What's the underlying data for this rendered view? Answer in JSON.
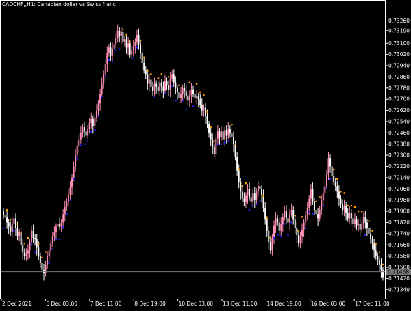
{
  "header": {
    "symbol_label": "CADCHF,,H1:  Canadian dollar vs Swiss franc"
  },
  "colors": {
    "background": "#000000",
    "axis": "#ffffff",
    "bull_candle": "#ff8fb4",
    "bear_candle": "#ffffff",
    "dot_support": "#2222ff",
    "dot_resistance": "#ffa500",
    "price_line": "#787878",
    "price_tag_bg": "#787878"
  },
  "chart_data": {
    "type": "candlestick",
    "title": "CADCHF,,H1:  Canadian dollar vs Swiss franc",
    "ylim": [
      0.713,
      0.7336
    ],
    "y_ticks": [
      "0.73260",
      "0.73190",
      "0.73100",
      "0.73020",
      "0.72940",
      "0.72860",
      "0.72780",
      "0.72700",
      "0.72620",
      "0.72540",
      "0.72460",
      "0.72380",
      "0.72300",
      "0.72220",
      "0.72140",
      "0.72060",
      "0.71980",
      "0.71900",
      "0.71820",
      "0.71740",
      "0.71660",
      "0.71580",
      "0.71500",
      "0.71420",
      "0.71340"
    ],
    "x_ticks": [
      "2 Dec 2021",
      "6 Dec 03:00",
      "7 Dec 11:00",
      "8 Dec 19:00",
      "10 Dec 03:00",
      "13 Dec 11:00",
      "14 Dec 19:00",
      "16 Dec 03:00",
      "17 Dec 11:00"
    ],
    "current_price": "0.71468",
    "current_price_value": 0.71468,
    "grid": false,
    "legend": "none",
    "series": [
      {
        "type": "close",
        "values": [
          0.7187,
          0.7186,
          0.7182,
          0.7179,
          0.7175,
          0.7181,
          0.7185,
          0.7178,
          0.7172,
          0.7175,
          0.7166,
          0.7161,
          0.7158,
          0.716,
          0.7162,
          0.7168,
          0.7176,
          0.7171,
          0.717,
          0.7164,
          0.7158,
          0.7153,
          0.7148,
          0.7146,
          0.7152,
          0.7158,
          0.7162,
          0.7167,
          0.7172,
          0.7175,
          0.7179,
          0.7181,
          0.7179,
          0.7182,
          0.7188,
          0.7193,
          0.7197,
          0.7202,
          0.7207,
          0.7214,
          0.7222,
          0.723,
          0.7237,
          0.7241,
          0.7246,
          0.725,
          0.7247,
          0.7244,
          0.7249,
          0.7253,
          0.7256,
          0.7251,
          0.7257,
          0.7262,
          0.7267,
          0.7274,
          0.7281,
          0.7288,
          0.7295,
          0.7303,
          0.7307,
          0.7301,
          0.7306,
          0.7309,
          0.7314,
          0.7319,
          0.7315,
          0.7318,
          0.7311,
          0.7313,
          0.7307,
          0.731,
          0.7302,
          0.7305,
          0.7308,
          0.7311,
          0.7316,
          0.7309,
          0.7303,
          0.7296,
          0.7291,
          0.7288,
          0.7281,
          0.7284,
          0.7279,
          0.7276,
          0.7281,
          0.7279,
          0.7276,
          0.7282,
          0.7279,
          0.7276,
          0.7283,
          0.728,
          0.7277,
          0.7285,
          0.7288,
          0.7282,
          0.7278,
          0.7275,
          0.7271,
          0.7274,
          0.7278,
          0.7276,
          0.7272,
          0.7269,
          0.7273,
          0.7277,
          0.7274,
          0.7271,
          0.7272,
          0.727,
          0.7266,
          0.7262,
          0.7264,
          0.7258,
          0.7252,
          0.7246,
          0.7241,
          0.7236,
          0.7231,
          0.7242,
          0.7247,
          0.7243,
          0.7247,
          0.7241,
          0.7248,
          0.7244,
          0.7249,
          0.7246,
          0.7243,
          0.7238,
          0.7229,
          0.7219,
          0.7211,
          0.7204,
          0.7199,
          0.7197,
          0.7201,
          0.7206,
          0.72,
          0.7197,
          0.7203,
          0.7198,
          0.7204,
          0.7208,
          0.7206,
          0.7202,
          0.7192,
          0.7184,
          0.7176,
          0.7168,
          0.7162,
          0.7171,
          0.718,
          0.7185,
          0.7182,
          0.7176,
          0.7181,
          0.7186,
          0.719,
          0.7185,
          0.7182,
          0.7188,
          0.7191,
          0.7184,
          0.7178,
          0.7173,
          0.7167,
          0.7172,
          0.7177,
          0.7182,
          0.7187,
          0.7192,
          0.7199,
          0.7206,
          0.7197,
          0.7191,
          0.7188,
          0.7185,
          0.7191,
          0.7198,
          0.7203,
          0.7208,
          0.7216,
          0.7228,
          0.7222,
          0.7215,
          0.7211,
          0.7208,
          0.7204,
          0.7199,
          0.7195,
          0.7191,
          0.7194,
          0.7189,
          0.7185,
          0.7189,
          0.7185,
          0.7181,
          0.7184,
          0.718,
          0.7181,
          0.7177,
          0.7181,
          0.7186,
          0.7182,
          0.7178,
          0.7174,
          0.717,
          0.7167,
          0.7162,
          0.7158,
          0.7155,
          0.7152,
          0.7148,
          0.7143
        ]
      },
      {
        "type": "support_dots",
        "color": "#2222ff"
      },
      {
        "type": "resistance_dots",
        "color": "#ffa500"
      }
    ]
  }
}
